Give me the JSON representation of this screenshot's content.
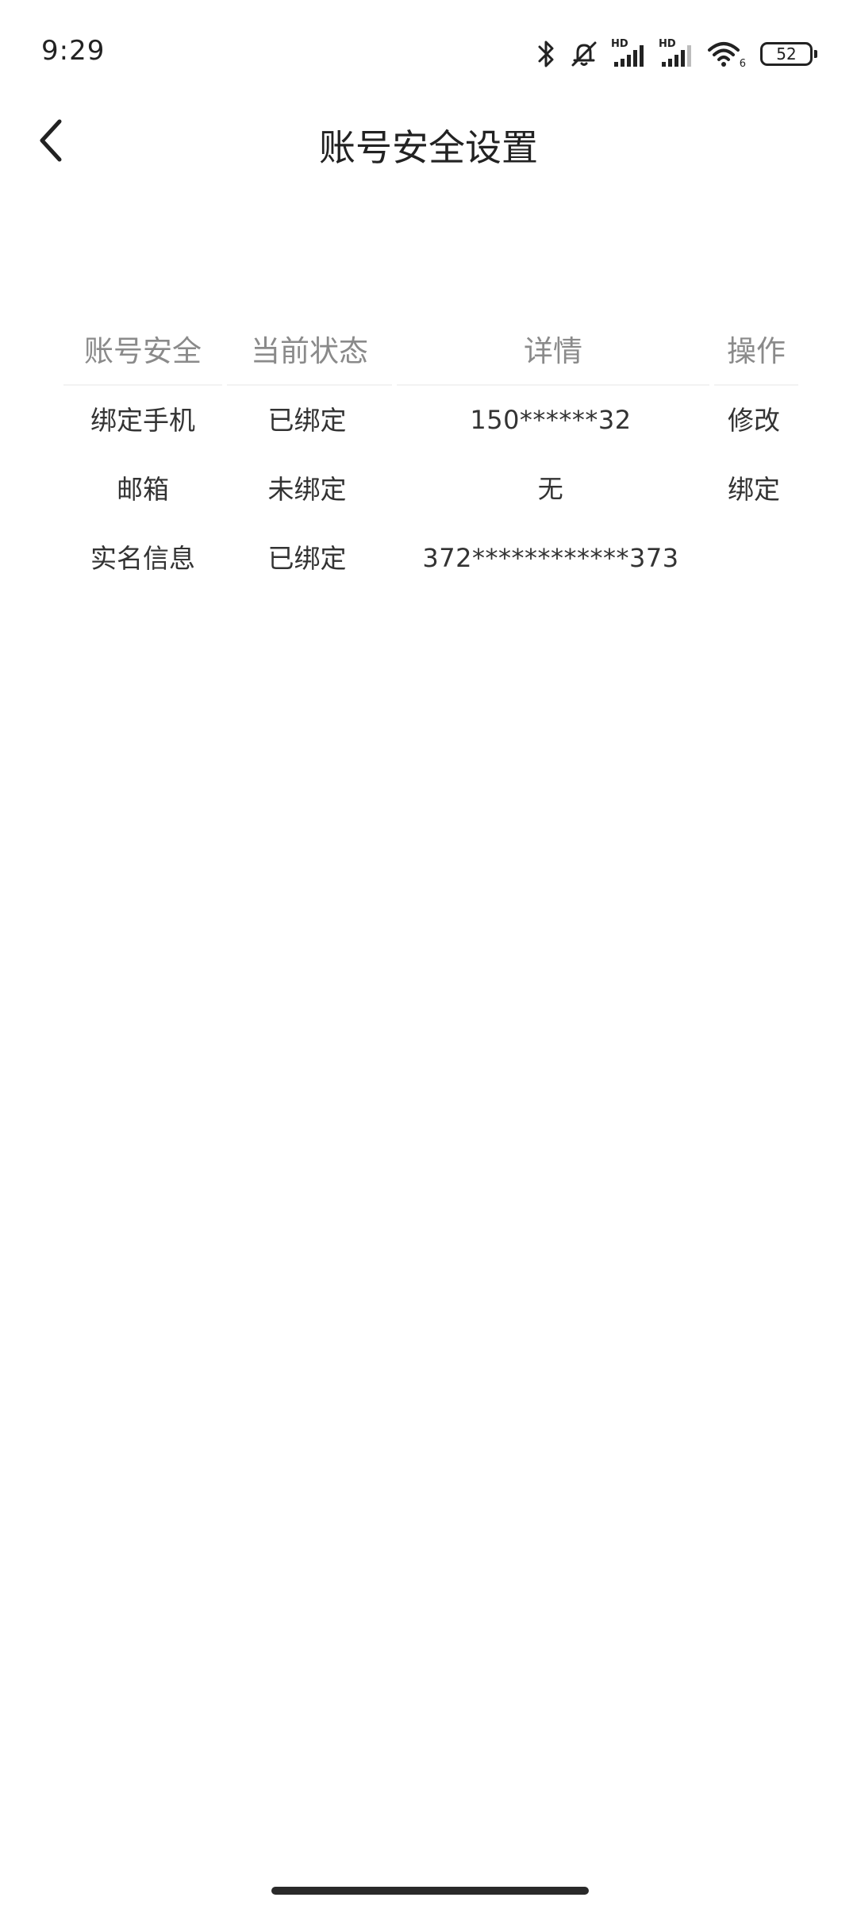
{
  "status_bar": {
    "time": "9:29",
    "signal_1_label": "HD",
    "signal_2_label": "HD",
    "wifi_label": "6",
    "battery": "52"
  },
  "header": {
    "title": "账号安全设置"
  },
  "table": {
    "columns": [
      "账号安全",
      "当前状态",
      "详情",
      "操作"
    ],
    "rows": [
      {
        "item": "绑定手机",
        "status": "已绑定",
        "detail": "150******32",
        "action": "修改"
      },
      {
        "item": "邮箱",
        "status": "未绑定",
        "detail": "无",
        "action": "绑定"
      },
      {
        "item": "实名信息",
        "status": "已绑定",
        "detail": "372************373",
        "action": ""
      }
    ]
  },
  "colors": {
    "action_link": "#5b9ac9",
    "header_text": "#8a8a8a",
    "body_text": "#333333"
  }
}
